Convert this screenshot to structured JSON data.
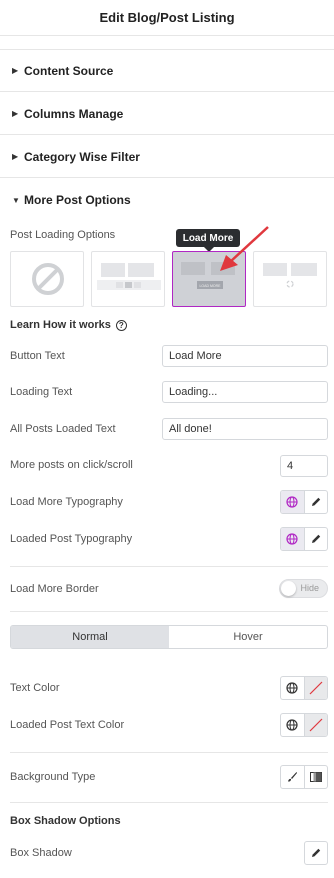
{
  "header": {
    "title": "Edit Blog/Post Listing"
  },
  "sections": [
    {
      "label": "Content Source",
      "expanded": false
    },
    {
      "label": "Columns Manage",
      "expanded": false
    },
    {
      "label": "Category Wise Filter",
      "expanded": false
    },
    {
      "label": "More Post Options",
      "expanded": true
    }
  ],
  "more_post_options": {
    "post_loading_label": "Post Loading Options",
    "options": [
      "none",
      "pagination",
      "load-more",
      "lazy-load"
    ],
    "selected": "load-more",
    "tooltip": "Load More",
    "selected_preview_label": "LOAD MORE",
    "learn_label": "Learn How it works",
    "button_text": {
      "label": "Button Text",
      "value": "Load More"
    },
    "loading_text": {
      "label": "Loading Text",
      "value": "Loading..."
    },
    "all_loaded_text": {
      "label": "All Posts Loaded Text",
      "value": "All done!"
    },
    "more_posts": {
      "label": "More posts on click/scroll",
      "value": "4"
    },
    "load_more_typography": "Load More Typography",
    "loaded_post_typography": "Loaded Post Typography",
    "load_more_border": {
      "label": "Load More Border",
      "toggle": "Hide"
    },
    "state_tabs": [
      "Normal",
      "Hover"
    ],
    "active_tab": "Normal",
    "text_color": "Text Color",
    "loaded_post_text_color": "Loaded Post Text Color",
    "background_type": "Background Type",
    "box_shadow_options": "Box Shadow Options",
    "box_shadow": "Box Shadow"
  },
  "colors": {
    "accent": "#b027c4",
    "arrow": "#e0383e"
  }
}
